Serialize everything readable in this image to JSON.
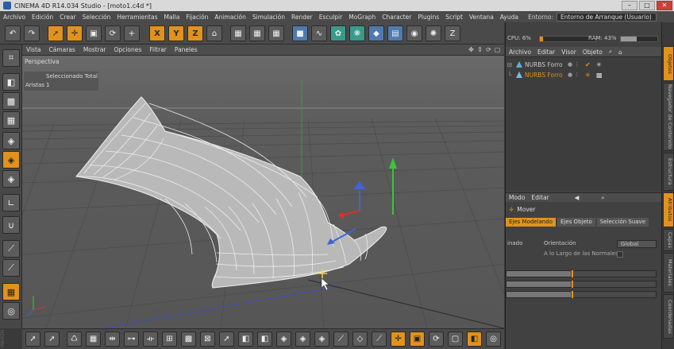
{
  "window": {
    "title": "CINEMA 4D R14.034 Studio - [moto1.c4d *]"
  },
  "menu": [
    "Archivo",
    "Edición",
    "Crear",
    "Selección",
    "Herramientas",
    "Malla",
    "Fijación",
    "Animación",
    "Simulación",
    "Render",
    "Esculpir",
    "MoGraph",
    "Character",
    "Plugins",
    "Script",
    "Ventana",
    "Ayuda"
  ],
  "environment": {
    "label": "Entorno:",
    "value": "Entorno de Arranque (Usuario)"
  },
  "stats": {
    "cpu": "CPU: 6%",
    "cpu_fraction": 0.06,
    "ram": "RAM: 43%",
    "ram_fraction": 0.43
  },
  "viewport": {
    "menu": [
      "Vista",
      "Cámaras",
      "Mostrar",
      "Opciones",
      "Filtrar",
      "Paneles"
    ],
    "label": "Perspectiva",
    "hud_selected": "Seleccionado Total",
    "hud_edges_label": "Aristas",
    "hud_edges_value": "1"
  },
  "object_manager": {
    "menu": [
      "Archivo",
      "Editar",
      "Visor",
      "Objeto"
    ],
    "objects": [
      {
        "name": "NURBS Forro",
        "selected": false
      },
      {
        "name": "NURBS Forro",
        "selected": true
      }
    ]
  },
  "attribute_manager": {
    "menu": [
      "Modo",
      "Editar"
    ],
    "title": "Mover",
    "tabs": [
      "Ejes Modelando",
      "Ejes Objeto",
      "Selección Suave"
    ],
    "row1_left": "inado",
    "orientation_label": "Orientación",
    "orientation_value": "Global",
    "normals_label": "A lo Largo de las Normales"
  },
  "side_tabs": [
    "Objetos",
    "Navegador de Contenido",
    "Estructura",
    "Atributos",
    "Capas",
    "Materiales",
    "Coordenadas"
  ],
  "colors": {
    "accent": "#e2921c",
    "x_axis": "#d9322a",
    "y_axis": "#3cc43c",
    "z_axis": "#3e63d8"
  }
}
